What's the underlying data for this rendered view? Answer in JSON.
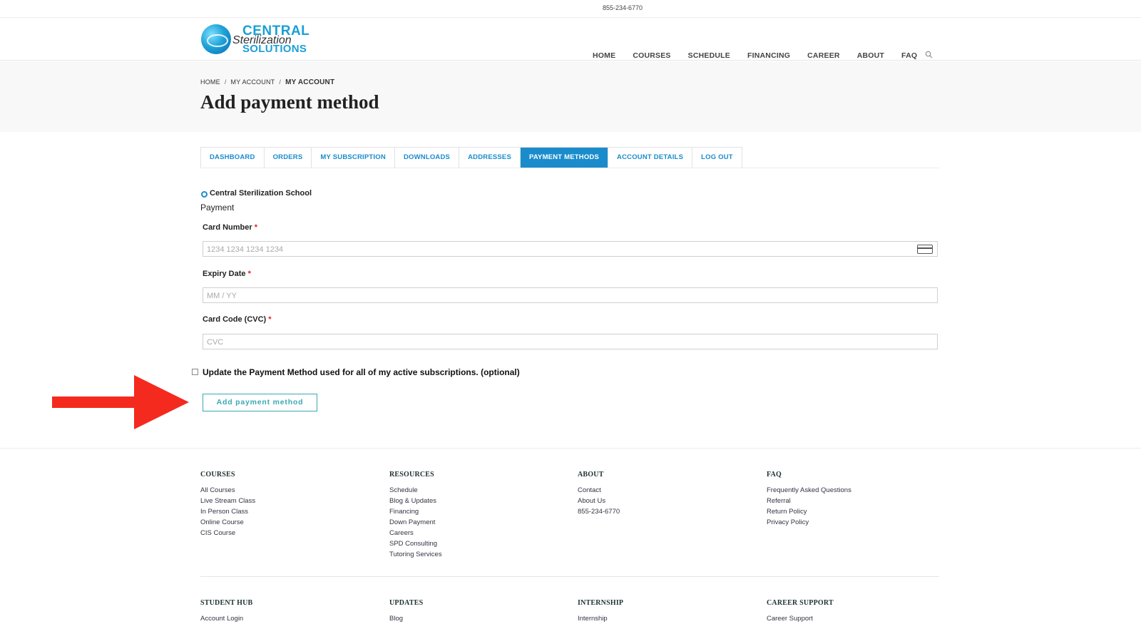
{
  "topbar": {
    "phone": "855-234-6770"
  },
  "logo": {
    "line1": "CENTRAL",
    "line2": "Sterilization",
    "line3": "SOLUTIONS"
  },
  "nav": {
    "items": [
      "HOME",
      "COURSES",
      "SCHEDULE",
      "FINANCING",
      "CAREER",
      "ABOUT",
      "FAQ"
    ],
    "search_icon": "search-icon"
  },
  "breadcrumb": {
    "home": "HOME",
    "parent": "MY ACCOUNT",
    "current": "MY ACCOUNT"
  },
  "page_title": "Add payment method",
  "tabs": [
    {
      "label": "DASHBOARD",
      "active": false
    },
    {
      "label": "ORDERS",
      "active": false
    },
    {
      "label": "MY SUBSCRIPTION",
      "active": false
    },
    {
      "label": "DOWNLOADS",
      "active": false
    },
    {
      "label": "ADDRESSES",
      "active": false
    },
    {
      "label": "PAYMENT METHODS",
      "active": true
    },
    {
      "label": "ACCOUNT DETAILS",
      "active": false
    },
    {
      "label": "LOG OUT",
      "active": false
    }
  ],
  "payment": {
    "gateway": "Central Sterilization School",
    "section_label": "Payment",
    "card_number": {
      "label": "Card Number",
      "required": "*",
      "value": "",
      "placeholder": "1234 1234 1234 1234"
    },
    "expiry": {
      "label": "Expiry Date",
      "required": "*",
      "value": "",
      "placeholder": "MM / YY"
    },
    "cvc": {
      "label": "Card Code (CVC)",
      "required": "*",
      "value": "",
      "placeholder": "CVC"
    },
    "update_all_label": "Update the Payment Method used for all of my active subscriptions. (optional)",
    "submit_label": "Add payment method"
  },
  "footer": {
    "columns": [
      {
        "title": "COURSES",
        "links": [
          "All Courses",
          "Live Stream Class",
          "In Person Class",
          "Online Course",
          "CIS Course"
        ]
      },
      {
        "title": "RESOURCES",
        "links": [
          "Schedule",
          "Blog & Updates",
          "Financing",
          "Down Payment",
          "Careers",
          "SPD Consulting",
          "Tutoring Services"
        ]
      },
      {
        "title": "ABOUT",
        "links": [
          "Contact",
          "About Us",
          "855-234-6770"
        ]
      },
      {
        "title": "FAQ",
        "links": [
          "Frequently Asked Questions",
          "Referral",
          "Return Policy",
          "Privacy Policy"
        ]
      }
    ],
    "columns2": [
      {
        "title": "STUDENT HUB",
        "links": [
          "Account Login"
        ]
      },
      {
        "title": "UPDATES",
        "links": [
          "Blog"
        ]
      },
      {
        "title": "INTERNSHIP",
        "links": [
          "Internship"
        ]
      },
      {
        "title": "CAREER SUPPORT",
        "links": [
          "Career Support"
        ]
      }
    ]
  },
  "colors": {
    "accent": "#1a8ccc",
    "button": "#3aa8b5",
    "arrow": "#f42a1f"
  }
}
